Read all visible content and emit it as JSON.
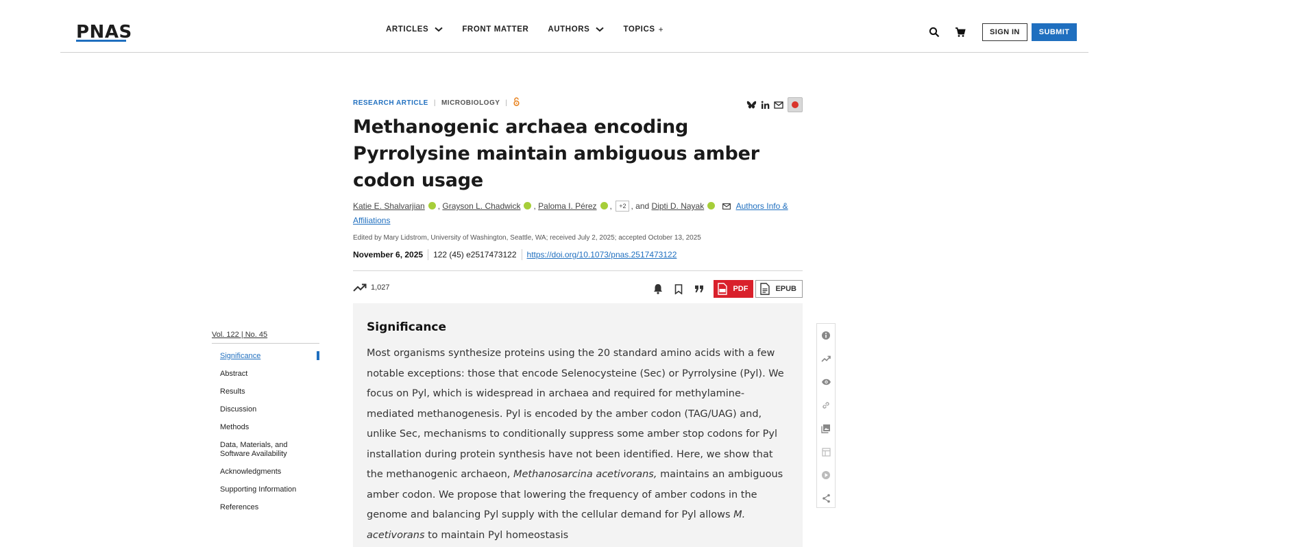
{
  "header": {
    "logo": "PNAS",
    "nav": [
      {
        "label": "ARTICLES",
        "chevron": true
      },
      {
        "label": "FRONT MATTER",
        "chevron": false
      },
      {
        "label": "AUTHORS",
        "chevron": true
      }
    ],
    "topics": {
      "label": "TOPICS",
      "suffix": "+"
    },
    "search_icon": "search-icon",
    "cart_icon": "cart-icon",
    "signin_label": "SIGN IN",
    "submit_label": "SUBMIT"
  },
  "article": {
    "type": "RESEARCH ARTICLE",
    "sep": "|",
    "category": "MICROBIOLOGY",
    "title": "Methanogenic archaea encoding Pyrrolysine maintain ambiguous amber codon usage",
    "authors": [
      "Katie E. Shalvarjian",
      "Grayson L. Chadwick",
      "Paloma I. Pérez",
      "Dipti D. Nayak"
    ],
    "more_authors": "+2",
    "and_text": ", and",
    "comma": ",",
    "affiliations_link": "Authors Info & Affiliations",
    "edited": "Edited by Mary Lidstrom, University of Washington, Seattle, WA; received July 2, 2025; accepted October 13, 2025",
    "date": "November 6, 2025",
    "volume_issue": "122 (45) e2517473122",
    "doi": "https://doi.org/10.1073/pnas.2517473122",
    "metric": "1,027",
    "pdf_label": "PDF",
    "epub_label": "EPUB"
  },
  "toc": {
    "volume": "Vol. 122 | No. 45",
    "items": [
      "Significance",
      "Abstract",
      "Results",
      "Discussion",
      "Methods",
      "Data, Materials, and Software Availability",
      "Acknowledgments",
      "Supporting Information",
      "References"
    ],
    "active_index": 0
  },
  "significance": {
    "heading": "Significance",
    "text_1": "Most organisms synthesize proteins using the 20 standard amino acids with a few notable exceptions: those that encode Selenocysteine (Sec) or Pyrrolysine (Pyl). We focus on Pyl, which is widespread in archaea and required for methylamine-mediated methanogenesis. Pyl is encoded by the amber codon (TAG/UAG) and, unlike Sec, mechanisms to conditionally suppress some amber stop codons for Pyl installation during protein synthesis have not been identified. Here, we show that the methanogenic archaeon, ",
    "species_full": "Methanosarcina acetivorans,",
    "text_2": " maintains an ambiguous amber codon. We propose that lowering the frequency of amber codons in the genome and balancing Pyl supply with the cellular demand for Pyl allows ",
    "species_short": "M. acetivorans",
    "text_3": " to maintain Pyl homeostasis"
  },
  "rail_icons": [
    "info-icon",
    "trending-icon",
    "eye-icon",
    "link-icon",
    "images-icon",
    "table-icon",
    "play-icon",
    "share-icon"
  ],
  "colors": {
    "accent": "#1f6fbf",
    "pdf": "#d9202b",
    "orcid": "#a6ce39",
    "open_access": "#e8821e",
    "panel_bg": "#f3f3f3"
  }
}
